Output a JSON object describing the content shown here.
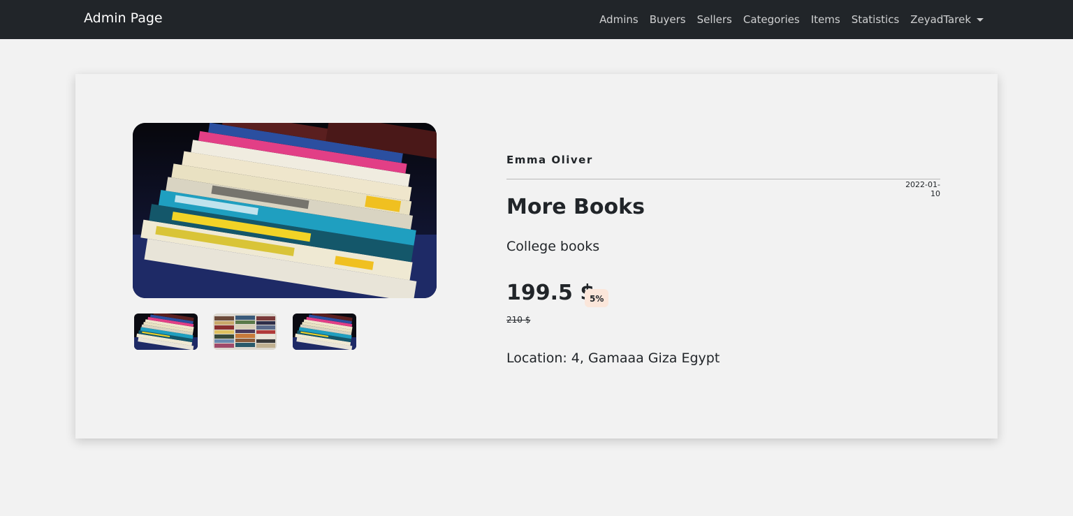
{
  "navbar": {
    "brand": "Admin Page",
    "links": [
      "Admins",
      "Buyers",
      "Sellers",
      "Categories",
      "Items",
      "Statistics"
    ],
    "user": "ZeyadTarek"
  },
  "item": {
    "seller": "Emma Oliver",
    "date": "2022-01-10",
    "title": "More Books",
    "description": "College books",
    "price": "199.5 $",
    "discount": "5%",
    "old_price": "210 $",
    "location": "Location: 4, Gamaaa Giza Egypt"
  },
  "images": {
    "main": "stacked-textbooks-photo",
    "thumbnails": [
      "stacked-textbooks-photo",
      "book-piles-photo",
      "stacked-textbooks-photo"
    ]
  },
  "colors": {
    "navbar_bg": "#212529",
    "page_bg": "#f2f2f2",
    "badge_bg": "#fbe6da"
  }
}
